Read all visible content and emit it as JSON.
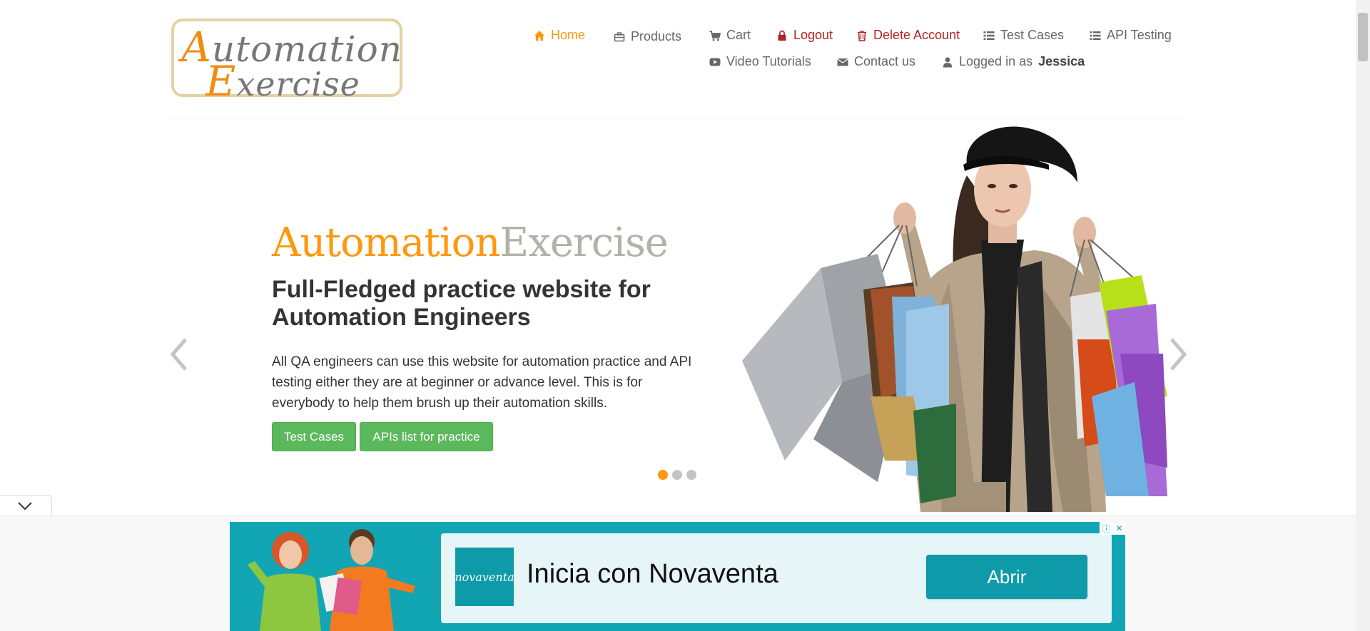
{
  "logo": {
    "line1": "utomation",
    "line1_cap": "A",
    "line2": "xercise",
    "line2_cap": "E"
  },
  "nav": {
    "home": "Home",
    "products": "Products",
    "cart": "Cart",
    "logout": "Logout",
    "delete_account": "Delete Account",
    "test_cases": "Test Cases",
    "api_testing": "API Testing",
    "video_tutorials": "Video Tutorials",
    "contact_us": "Contact us",
    "logged_in_prefix": "Logged in as",
    "logged_in_user": "Jessica"
  },
  "slider": {
    "brand_part1": "Automation",
    "brand_part2": "Exercise",
    "headline": "Full-Fledged practice website for Automation Engineers",
    "description": "All QA engineers can use this website for automation practice and API testing either they are at beginner or advance level. This is for everybody to help them brush up their automation skills.",
    "btn_test_cases": "Test Cases",
    "btn_apis": "APIs list for practice",
    "active_slide": 1,
    "slide_count": 3
  },
  "ad": {
    "logo_text": "novaventa",
    "title": "Inicia con Novaventa",
    "button": "Abrir"
  },
  "colors": {
    "accent": "#fe980f",
    "danger": "#b22222",
    "button_green": "#5cb85c",
    "ad_teal": "#12a6b4"
  }
}
